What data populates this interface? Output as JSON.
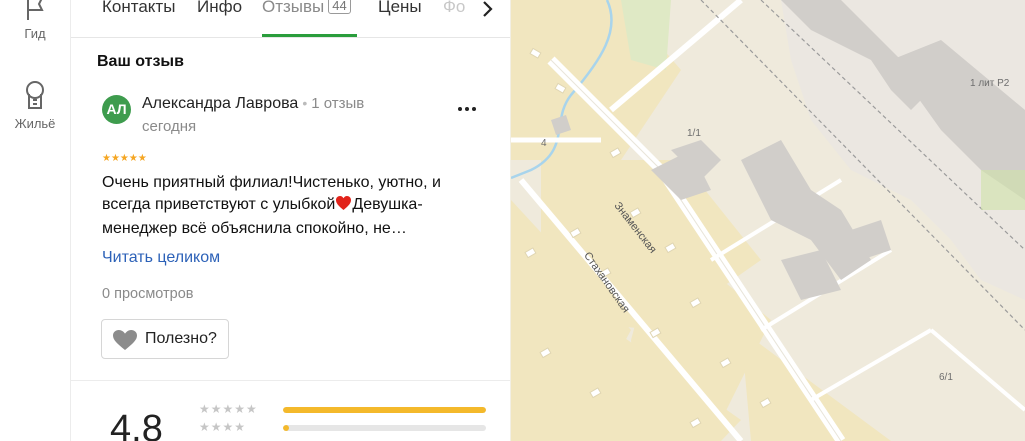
{
  "rail": {
    "items": [
      {
        "label": "Гид",
        "icon": "flag-icon"
      },
      {
        "label": "Жильё",
        "icon": "building-icon"
      }
    ]
  },
  "tabs": {
    "items": [
      {
        "label": "Контакты"
      },
      {
        "label": "Инфо"
      },
      {
        "label": "Отзывы",
        "badge": "44",
        "active": true
      },
      {
        "label": "Цены"
      },
      {
        "label": "Фо"
      }
    ],
    "more_icon": "chevron-right-icon"
  },
  "review": {
    "section_title": "Ваш отзыв",
    "avatar_initials": "АЛ",
    "author": "Александра Лаврова",
    "review_count": "1 отзыв",
    "date": "сегодня",
    "rating": 5,
    "text_line1": "Очень приятный филиал!Чистенько, уютно, и",
    "text_line2_a": "всегда приветствуют с улыбкой",
    "text_line2_b": "Девушка-",
    "text_line3": "менеджер всё объяснила спокойно, не…",
    "read_more": "Читать целиком",
    "views": "0 просмотров",
    "helpful": "Полезно?"
  },
  "summary": {
    "rating": "4.8",
    "distribution": [
      {
        "stars": 5,
        "fraction": 1.0
      },
      {
        "stars": 4,
        "fraction": 0.03
      }
    ]
  },
  "map": {
    "streets": [
      "Знаменская",
      "Стахановская"
    ],
    "labels": [
      "1 лит Р2",
      "1/1",
      "4",
      "6/1"
    ]
  },
  "colors": {
    "accent_green": "#2a9d3c",
    "link_blue": "#2d62b8",
    "star_gold": "#f5a623",
    "bar_gold": "#f4b92b",
    "heart_red": "#e2231a"
  }
}
